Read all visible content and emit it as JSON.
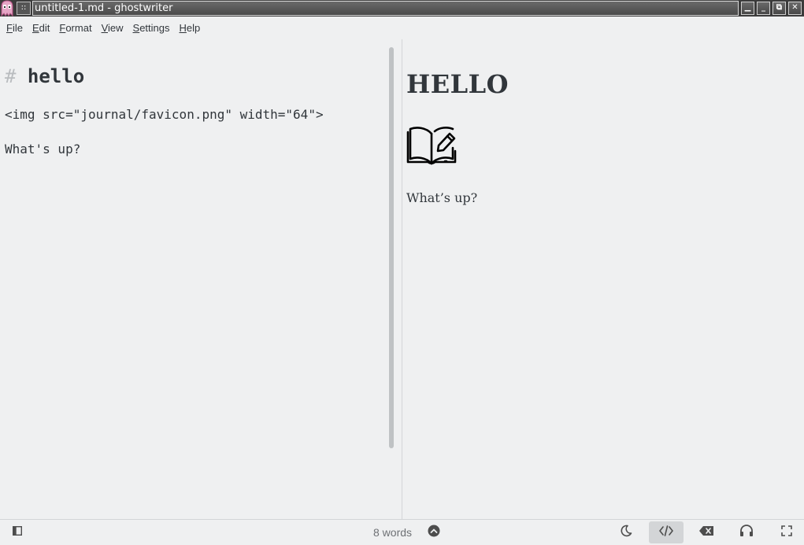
{
  "window": {
    "title": "untitled-1.md - ghostwriter",
    "grip_glyph": "::",
    "minimize_glyph": "_",
    "shade_glyph": "▁",
    "restore_glyph": "⧉",
    "close_glyph": "✕"
  },
  "menu": {
    "items": [
      {
        "mnemonic": "F",
        "rest": "ile"
      },
      {
        "mnemonic": "E",
        "rest": "dit"
      },
      {
        "mnemonic": "F",
        "rest": "ormat"
      },
      {
        "mnemonic": "V",
        "rest": "iew"
      },
      {
        "mnemonic": "S",
        "rest": "ettings"
      },
      {
        "mnemonic": "H",
        "rest": "elp"
      }
    ]
  },
  "editor": {
    "heading_marker": "#",
    "heading_text": "hello",
    "line_img": "<img src=\"journal/favicon.png\" width=\"64\">",
    "line_text": "What's up?"
  },
  "preview": {
    "heading": "HELLO",
    "paragraph": "What’s up?"
  },
  "statusbar": {
    "word_count": "8 words",
    "html_preview_active": true
  },
  "colors": {
    "background": "#eff0f1",
    "text": "#31363b",
    "icon": "#4d4d4d",
    "hash_marker": "#b9bcbf"
  }
}
